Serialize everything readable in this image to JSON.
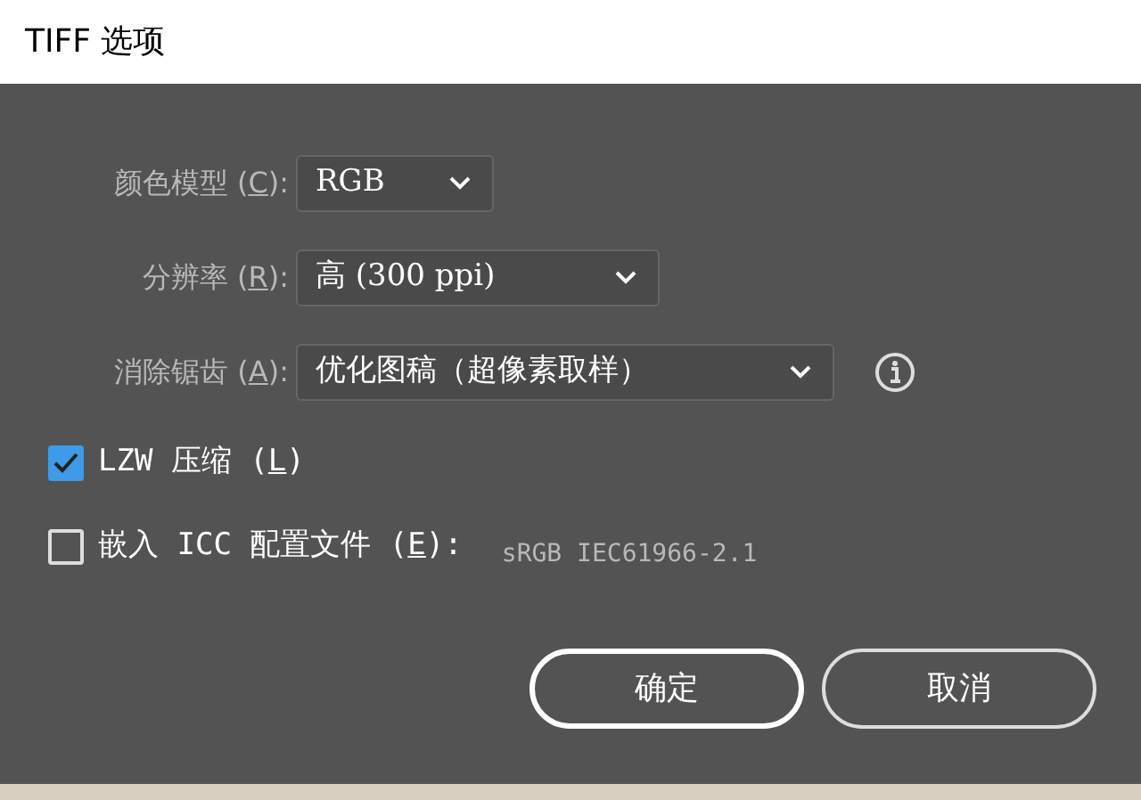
{
  "window": {
    "title": "TIFF 选项"
  },
  "fields": [
    {
      "text_before": "颜色模型 (",
      "access_key": "C",
      "text_after": "):",
      "value": "RGB"
    },
    {
      "text_before": "分辨率 (",
      "access_key": "R",
      "text_after": "):",
      "value": "高 (300 ppi)"
    },
    {
      "text_before": "消除锯齿 (",
      "access_key": "A",
      "text_after": "):",
      "value": "优化图稿（超像素取样）",
      "info": true
    }
  ],
  "options": [
    {
      "text_before": "LZW 压缩 (",
      "access_key": "L",
      "text_after": ")",
      "checked": true
    },
    {
      "text_before": "嵌入 ICC 配置文件 (",
      "access_key": "E",
      "text_after": "):",
      "checked": false,
      "detail": "sRGB IEC61966-2.1"
    }
  ],
  "buttons": [
    {
      "label": "确定"
    },
    {
      "label": "取消"
    }
  ]
}
